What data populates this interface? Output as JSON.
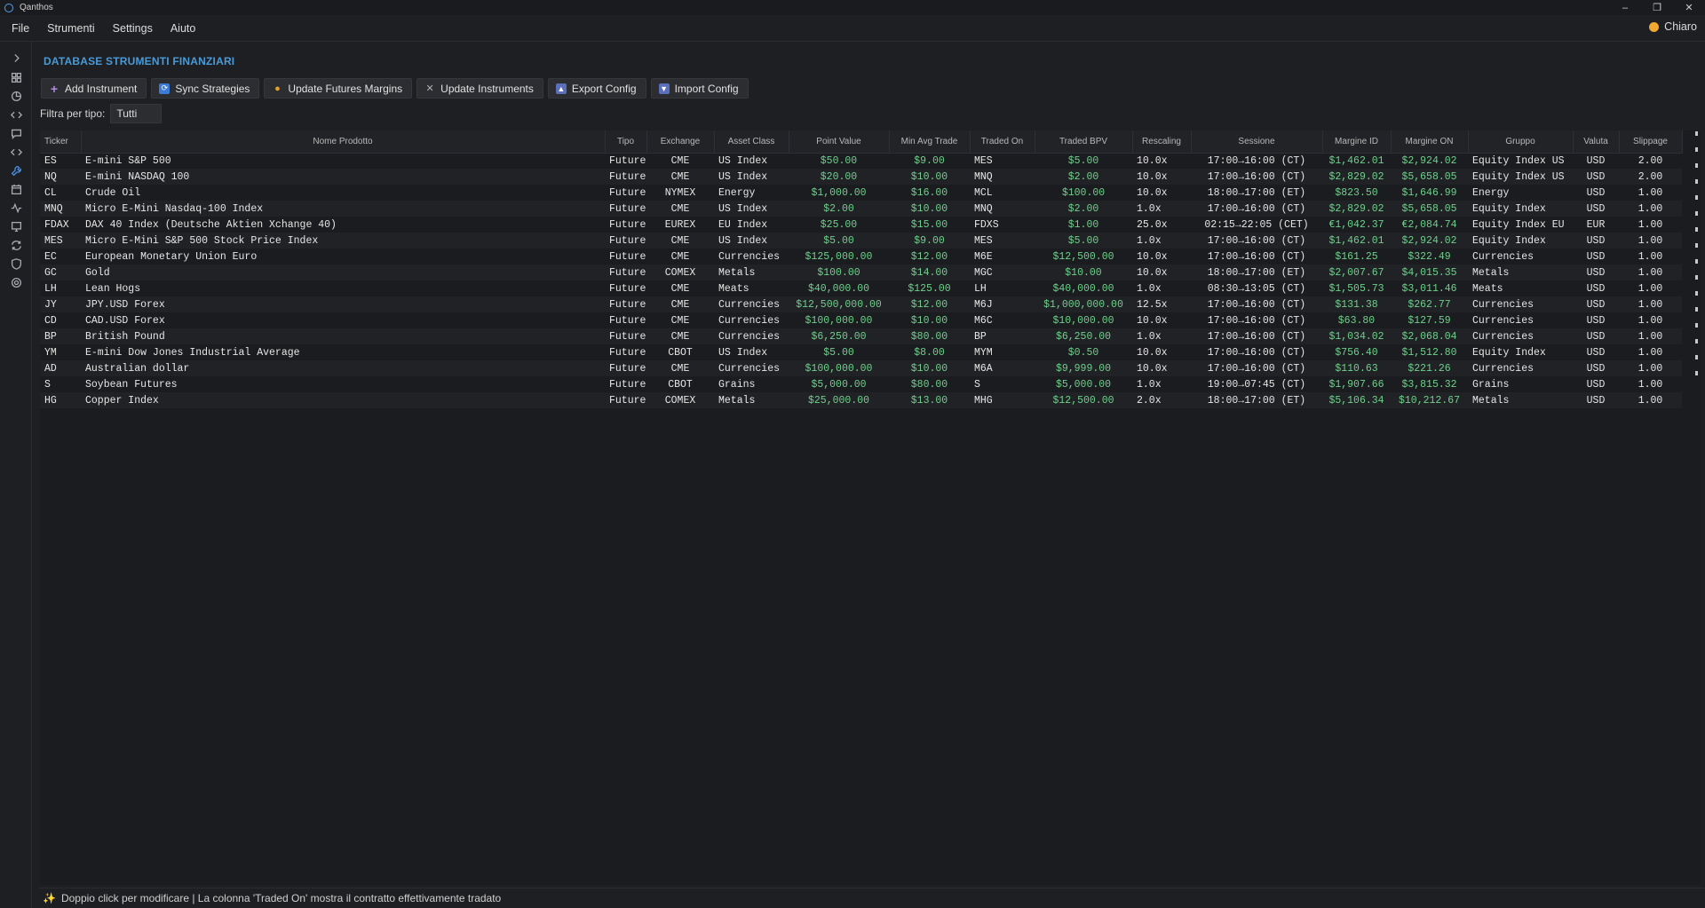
{
  "window": {
    "title": "Qanthos"
  },
  "menu": {
    "items": [
      "File",
      "Strumenti",
      "Settings",
      "Aiuto"
    ]
  },
  "theme": {
    "label": "Chiaro"
  },
  "page": {
    "title": "DATABASE STRUMENTI FINANZIARI"
  },
  "toolbar": {
    "add": "Add Instrument",
    "sync": "Sync Strategies",
    "update_margins": "Update Futures Margins",
    "update_instruments": "Update Instruments",
    "export": "Export Config",
    "import": "Import Config"
  },
  "filter": {
    "label": "Filtra per tipo:",
    "value": "Tutti"
  },
  "table": {
    "headers": [
      "Ticker",
      "Nome Prodotto",
      "Tipo",
      "Exchange",
      "Asset Class",
      "Point Value",
      "Min Avg Trade",
      "Traded On",
      "Traded BPV",
      "Rescaling",
      "Sessione",
      "Margine ID",
      "Margine ON",
      "Gruppo",
      "Valuta",
      "Slippage"
    ],
    "rows": [
      [
        "ES",
        "E-mini S&P 500",
        "Future",
        "CME",
        "US Index",
        "$50.00",
        "$9.00",
        "MES",
        "$5.00",
        "10.0x",
        "17:00→16:00 (CT)",
        "$1,462.01",
        "$2,924.02",
        "Equity Index US",
        "USD",
        "2.00"
      ],
      [
        "NQ",
        "E-mini NASDAQ 100",
        "Future",
        "CME",
        "US Index",
        "$20.00",
        "$10.00",
        "MNQ",
        "$2.00",
        "10.0x",
        "17:00→16:00 (CT)",
        "$2,829.02",
        "$5,658.05",
        "Equity Index US",
        "USD",
        "2.00"
      ],
      [
        "CL",
        "Crude Oil",
        "Future",
        "NYMEX",
        "Energy",
        "$1,000.00",
        "$16.00",
        "MCL",
        "$100.00",
        "10.0x",
        "18:00→17:00 (ET)",
        "$823.50",
        "$1,646.99",
        "Energy",
        "USD",
        "1.00"
      ],
      [
        "MNQ",
        "Micro E-Mini Nasdaq-100 Index",
        "Future",
        "CME",
        "US Index",
        "$2.00",
        "$10.00",
        "MNQ",
        "$2.00",
        "1.0x",
        "17:00→16:00 (CT)",
        "$2,829.02",
        "$5,658.05",
        "Equity Index",
        "USD",
        "1.00"
      ],
      [
        "FDAX",
        "DAX 40 Index (Deutsche Aktien Xchange 40)",
        "Future",
        "EUREX",
        "EU Index",
        "$25.00",
        "$15.00",
        "FDXS",
        "$1.00",
        "25.0x",
        "02:15→22:05 (CET)",
        "€1,042.37",
        "€2,084.74",
        "Equity Index EU",
        "EUR",
        "1.00"
      ],
      [
        "MES",
        "Micro E-Mini S&P 500 Stock Price Index",
        "Future",
        "CME",
        "US Index",
        "$5.00",
        "$9.00",
        "MES",
        "$5.00",
        "1.0x",
        "17:00→16:00 (CT)",
        "$1,462.01",
        "$2,924.02",
        "Equity Index",
        "USD",
        "1.00"
      ],
      [
        "EC",
        "European Monetary Union Euro",
        "Future",
        "CME",
        "Currencies",
        "$125,000.00",
        "$12.00",
        "M6E",
        "$12,500.00",
        "10.0x",
        "17:00→16:00 (CT)",
        "$161.25",
        "$322.49",
        "Currencies",
        "USD",
        "1.00"
      ],
      [
        "GC",
        "Gold",
        "Future",
        "COMEX",
        "Metals",
        "$100.00",
        "$14.00",
        "MGC",
        "$10.00",
        "10.0x",
        "18:00→17:00 (ET)",
        "$2,007.67",
        "$4,015.35",
        "Metals",
        "USD",
        "1.00"
      ],
      [
        "LH",
        "Lean Hogs",
        "Future",
        "CME",
        "Meats",
        "$40,000.00",
        "$125.00",
        "LH",
        "$40,000.00",
        "1.0x",
        "08:30→13:05 (CT)",
        "$1,505.73",
        "$3,011.46",
        "Meats",
        "USD",
        "1.00"
      ],
      [
        "JY",
        "JPY.USD Forex",
        "Future",
        "CME",
        "Currencies",
        "$12,500,000.00",
        "$12.00",
        "M6J",
        "$1,000,000.00",
        "12.5x",
        "17:00→16:00 (CT)",
        "$131.38",
        "$262.77",
        "Currencies",
        "USD",
        "1.00"
      ],
      [
        "CD",
        "CAD.USD Forex",
        "Future",
        "CME",
        "Currencies",
        "$100,000.00",
        "$10.00",
        "M6C",
        "$10,000.00",
        "10.0x",
        "17:00→16:00 (CT)",
        "$63.80",
        "$127.59",
        "Currencies",
        "USD",
        "1.00"
      ],
      [
        "BP",
        "British Pound",
        "Future",
        "CME",
        "Currencies",
        "$6,250.00",
        "$80.00",
        "BP",
        "$6,250.00",
        "1.0x",
        "17:00→16:00 (CT)",
        "$1,034.02",
        "$2,068.04",
        "Currencies",
        "USD",
        "1.00"
      ],
      [
        "YM",
        "E-mini Dow Jones Industrial Average",
        "Future",
        "CBOT",
        "US Index",
        "$5.00",
        "$8.00",
        "MYM",
        "$0.50",
        "10.0x",
        "17:00→16:00 (CT)",
        "$756.40",
        "$1,512.80",
        "Equity Index",
        "USD",
        "1.00"
      ],
      [
        "AD",
        "Australian dollar",
        "Future",
        "CME",
        "Currencies",
        "$100,000.00",
        "$10.00",
        "M6A",
        "$9,999.00",
        "10.0x",
        "17:00→16:00 (CT)",
        "$110.63",
        "$221.26",
        "Currencies",
        "USD",
        "1.00"
      ],
      [
        "S",
        "Soybean Futures",
        "Future",
        "CBOT",
        "Grains",
        "$5,000.00",
        "$80.00",
        "S",
        "$5,000.00",
        "1.0x",
        "19:00→07:45 (CT)",
        "$1,907.66",
        "$3,815.32",
        "Grains",
        "USD",
        "1.00"
      ],
      [
        "HG",
        "Copper Index",
        "Future",
        "COMEX",
        "Metals",
        "$25,000.00",
        "$13.00",
        "MHG",
        "$12,500.00",
        "2.0x",
        "18:00→17:00 (ET)",
        "$5,106.34",
        "$10,212.67",
        "Metals",
        "USD",
        "1.00"
      ]
    ]
  },
  "status": {
    "text": "Doppio click per modificare | La colonna 'Traded On' mostra il contratto effettivamente tradato"
  }
}
